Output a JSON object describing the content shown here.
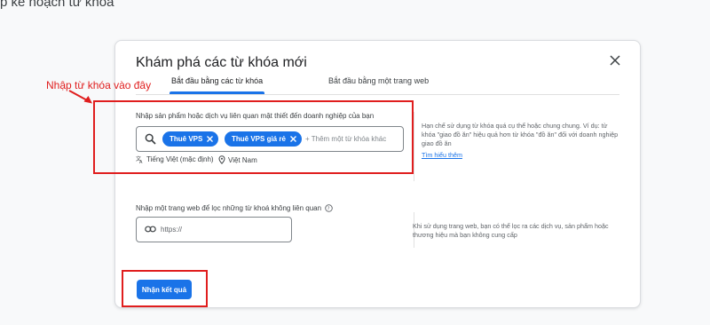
{
  "page": {
    "header": "p kế hoạch từ khóa"
  },
  "dialog": {
    "title": "Khám phá các từ khóa mới",
    "tabs": [
      {
        "label": "Bắt đầu bằng các từ khóa",
        "active": true
      },
      {
        "label": "Bắt đầu bằng một trang web",
        "active": false
      }
    ],
    "keywords": {
      "label": "Nhập sản phẩm hoặc dịch vụ liên quan mật thiết đến doanh nghiệp của bạn",
      "chips": [
        "Thuê VPS",
        "Thuê VPS giá rẻ"
      ],
      "placeholder": "+ Thêm một từ khóa khác",
      "language": "Tiếng Việt (mặc định)",
      "location": "Việt Nam",
      "help_text": "Hạn chế sử dụng từ khóa quá cụ thể hoặc chung chung. Ví dụ: từ khóa \"giao đồ ăn\" hiệu quả hơn từ khóa \"đồ ăn\" đối với doanh nghiệp giao đồ ăn",
      "help_link": "Tìm hiểu thêm"
    },
    "website": {
      "label": "Nhập một trang web để lọc những từ khoá không liên quan",
      "placeholder": "https://",
      "help_text": "Khi sử dụng trang web, bạn có thể lọc ra các dịch vụ, sản phẩm hoặc thương hiệu mà bạn không cung cấp"
    },
    "submit_label": "Nhận kết quả"
  },
  "annotation": {
    "text": "Nhập từ khóa vào đây",
    "color": "#e01e1e"
  },
  "colors": {
    "accent": "#1a73e8",
    "annotation": "#e01e1e"
  },
  "icons": [
    "close-icon",
    "search-icon",
    "translate-icon",
    "location-pin-icon",
    "help-circle-icon",
    "link-icon",
    "chip-close-icon"
  ]
}
